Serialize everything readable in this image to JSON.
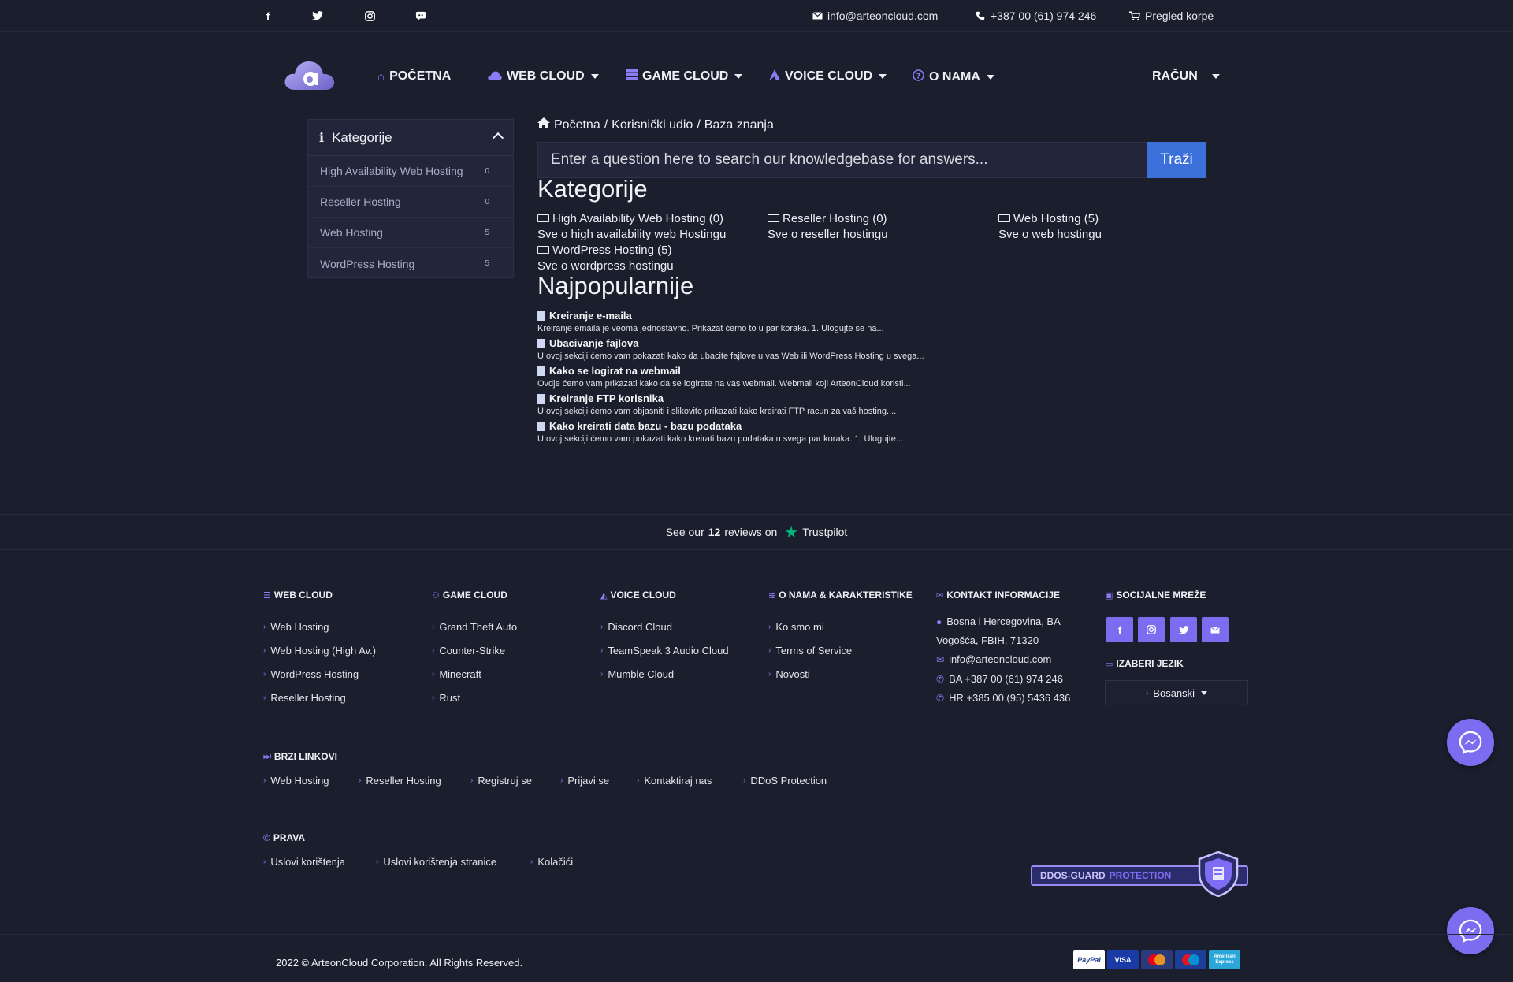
{
  "topbar": {
    "social": [
      "facebook-icon",
      "twitter-icon",
      "instagram-icon",
      "discord-icon"
    ],
    "email": "info@arteoncloud.com",
    "phone": "+387 00 (61) 974 246",
    "cart": "Pregled korpe"
  },
  "nav": {
    "items": [
      {
        "label": "POČETNA",
        "icon": "home-icon"
      },
      {
        "label": "WEB CLOUD",
        "icon": "cloud-icon"
      },
      {
        "label": "GAME CLOUD",
        "icon": "server-icon"
      },
      {
        "label": "VOICE CLOUD",
        "icon": "voice-icon"
      },
      {
        "label": "O NAMA",
        "icon": "question-icon"
      }
    ],
    "account": "RAČUN"
  },
  "sidebar": {
    "title": "Kategorije",
    "items": [
      {
        "label": "High Availability Web Hosting",
        "count": "0"
      },
      {
        "label": "Reseller Hosting",
        "count": "0"
      },
      {
        "label": "Web Hosting",
        "count": "5"
      },
      {
        "label": "WordPress Hosting",
        "count": "5"
      }
    ]
  },
  "breadcrumb": [
    "Početna",
    "Korisnički udio",
    "Baza znanja"
  ],
  "search": {
    "placeholder": "Enter a question here to search our knowledgebase for answers...",
    "button": "Traži"
  },
  "categories": {
    "title": "Kategorije",
    "items": [
      {
        "name": "High Availability Web Hosting (0)",
        "desc": "Sve o high availability web Hostingu"
      },
      {
        "name": "Reseller Hosting (0)",
        "desc": "Sve o reseller hostingu"
      },
      {
        "name": "Web Hosting (5)",
        "desc": "Sve o web hostingu"
      },
      {
        "name": "WordPress Hosting (5)",
        "desc": "Sve o wordpress hostingu"
      }
    ]
  },
  "popular": {
    "title": "Najpopularnije",
    "items": [
      {
        "title": "Kreiranje e-maila",
        "desc": "Kreiranje emaila je veoma jednostavno. Prikazat ćemo to u par koraka.   1. Ulogujte se na..."
      },
      {
        "title": "Ubacivanje fajlova",
        "desc": "U ovoj sekciji ćemo vam pokazati kako da ubacite fajlove u vas Web ili WordPress Hosting u svega..."
      },
      {
        "title": "Kako se logirat na webmail",
        "desc": "Ovdje ćemo vam prikazati kako da se logirate na vas webmail. Webmail koji ArteonCloud koristi..."
      },
      {
        "title": "Kreiranje FTP korisnika",
        "desc": "U ovoj sekciji ćemo vam objasniti i slikovito prikazati kako kreirati FTP racun za vaš hosting...."
      },
      {
        "title": "Kako kreirati data bazu - bazu podataka",
        "desc": "U ovoj sekciji ćemo vam pokazati kako kreirati bazu podataka u svega par koraka. 1. Ulogujte..."
      }
    ]
  },
  "trustpilot": {
    "prefix": "See our",
    "count": "12",
    "suffix": "reviews on",
    "brand": "Trustpilot"
  },
  "footer": {
    "web_cloud": {
      "title": "WEB CLOUD",
      "links": [
        "Web Hosting",
        "Web Hosting (High Av.)",
        "WordPress Hosting",
        "Reseller Hosting"
      ]
    },
    "game_cloud": {
      "title": "GAME CLOUD",
      "links": [
        "Grand Theft Auto",
        "Counter-Strike",
        "Minecraft",
        "Rust"
      ]
    },
    "voice_cloud": {
      "title": "VOICE CLOUD",
      "links": [
        "Discord Cloud",
        "TeamSpeak 3 Audio Cloud",
        "Mumble Cloud"
      ]
    },
    "about": {
      "title": "O NAMA & KARAKTERISTIKE",
      "links": [
        "Ko smo mi",
        "Terms of Service",
        "Novosti"
      ]
    },
    "contact": {
      "title": "KONTAKT INFORMACIJE",
      "address1": "Bosna i Hercegovina, BA",
      "address2": "Vogošća, FBIH, 71320",
      "email": "info@arteoncloud.com",
      "phone_ba": "BA +387 00 (61) 974 246",
      "phone_hr": "HR +385 00 (95) 5436 436"
    },
    "social": {
      "title": "SOCIJALNE MREŽE",
      "buttons": [
        "facebook-icon",
        "instagram-icon",
        "twitter-icon",
        "email-icon"
      ]
    },
    "language": {
      "title": "IZABERI JEZIK",
      "selected": "Bosanski"
    },
    "quick": {
      "title": "BRZI LINKOVI",
      "links": [
        "Web Hosting",
        "Reseller Hosting",
        "Registruj se",
        "Prijavi se",
        "Kontaktiraj nas",
        "DDoS Protection"
      ]
    },
    "rights": {
      "title": "PRAVA",
      "links": [
        "Uslovi korištenja",
        "Uslovi korištenja stranice",
        "Kolačići"
      ]
    },
    "ddos": {
      "part1": "DDOS-GUARD",
      "part2": "PROTECTION"
    },
    "copyright": "2022 © ArteonCloud Corporation. All Rights Reserved.",
    "payments": [
      "PayPal",
      "VISA",
      "Mastercard",
      "Maestro",
      "American Express"
    ]
  },
  "colors": {
    "accent": "#8b7cf6",
    "button": "#3b6fd9",
    "background": "#1b1e2d",
    "trustpilot": "#00b67a"
  }
}
